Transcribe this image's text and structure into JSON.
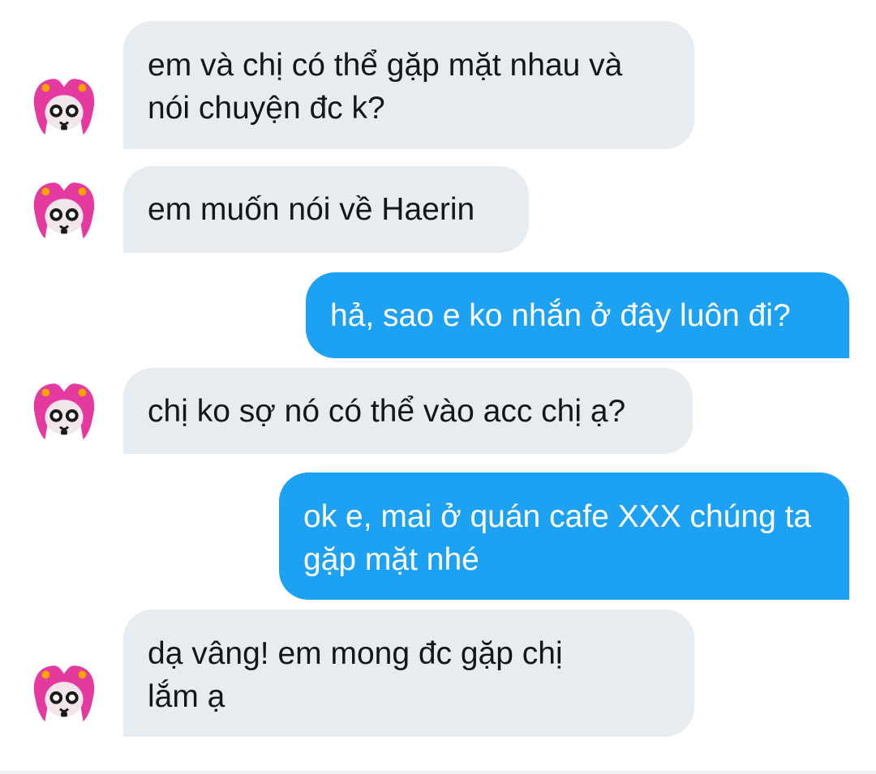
{
  "conversation": {
    "messages": [
      {
        "side": "received",
        "text": "em và chị có thể gặp mặt nhau và nói chuyện đc k?"
      },
      {
        "side": "received",
        "text": "em muốn nói về Haerin"
      },
      {
        "side": "sent",
        "text": "hả, sao e ko nhắn ở đây luôn đi?"
      },
      {
        "side": "received",
        "text": "chị ko sợ nó có thể vào acc chị ạ?"
      },
      {
        "side": "sent",
        "text": "ok e, mai ở quán cafe XXX chúng ta gặp mặt nhé"
      },
      {
        "side": "received",
        "text": "dạ vâng! em mong đc gặp chị lắm ạ"
      }
    ]
  },
  "colors": {
    "received_bubble": "#e6ecf0",
    "sent_bubble": "#1da1f2",
    "received_text": "#14171a",
    "sent_text": "#ffffff",
    "avatar_hair": "#e4399f"
  },
  "icons": {
    "avatar": "pink-haired-character-avatar"
  }
}
